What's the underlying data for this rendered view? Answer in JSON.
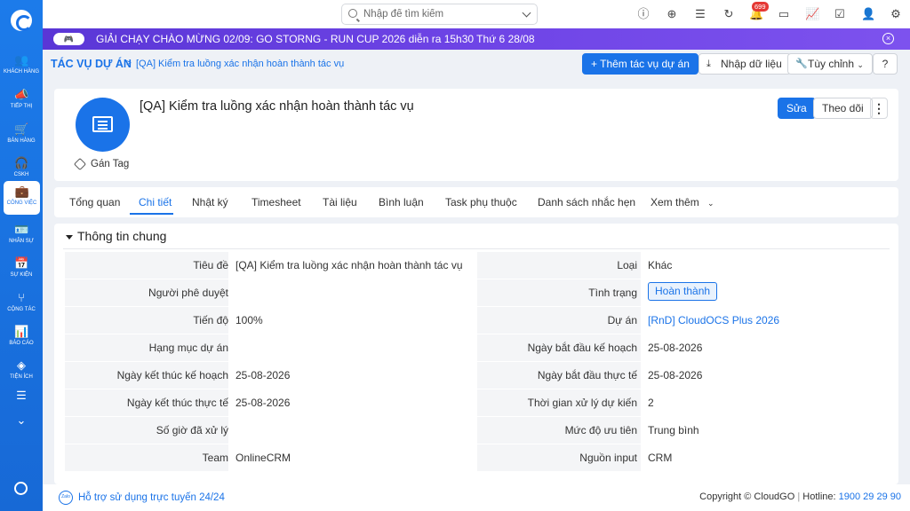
{
  "sidebar": {
    "items": [
      {
        "label": "KHÁCH HÀNG",
        "icon": "users-icon"
      },
      {
        "label": "TIẾP THỊ",
        "icon": "megaphone-icon"
      },
      {
        "label": "BÁN HÀNG",
        "icon": "cart-icon"
      },
      {
        "label": "CSKH",
        "icon": "headset-icon"
      },
      {
        "label": "CÔNG VIỆC",
        "icon": "briefcase-icon"
      },
      {
        "label": "NHÂN SỰ",
        "icon": "id-card-icon"
      },
      {
        "label": "SỰ KIỆN",
        "icon": "calendar-icon"
      },
      {
        "label": "CỘNG TÁC",
        "icon": "branch-icon"
      },
      {
        "label": "BÁO CÁO",
        "icon": "report-icon"
      },
      {
        "label": "TIỆN ÍCH",
        "icon": "layers-icon"
      }
    ]
  },
  "topbar": {
    "search_placeholder": "Nhập để tìm kiếm",
    "notification_count": "699"
  },
  "announcement": {
    "text": "GIẢI CHẠY CHÀO MỪNG 02/09: GO STORNG - RUN CUP 2026 diễn ra 15h30 Thứ 6 28/08"
  },
  "breadcrumb": {
    "root": "TÁC VỤ DỰ ÁN",
    "separator": ">",
    "current": "[QA] Kiểm tra luồng xác nhận hoàn thành tác vụ"
  },
  "actions": {
    "add_task": "+ Thêm tác vụ dự án",
    "import": "Nhập dữ liệu",
    "customize": "Tùy chỉnh",
    "help": "?"
  },
  "header": {
    "title": "[QA] Kiểm tra luồng xác nhận hoàn thành tác vụ",
    "tag_label": "Gán Tag",
    "edit": "Sửa",
    "follow": "Theo dõi"
  },
  "tabs": [
    "Tổng quan",
    "Chi tiết",
    "Nhật ký",
    "Timesheet",
    "Tài liệu",
    "Bình luận",
    "Task phụ thuộc",
    "Danh sách nhắc hẹn",
    "Xem thêm"
  ],
  "section": {
    "title": "Thông tin chung",
    "rows": [
      {
        "left_label": "Tiêu đề",
        "left_value": "[QA] Kiểm tra luồng xác nhận hoàn thành tác vụ",
        "right_label": "Loại",
        "right_value": "Khác"
      },
      {
        "left_label": "Người phê duyệt",
        "left_value": "",
        "right_label": "Tình trạng",
        "right_value": "Hoàn thành"
      },
      {
        "left_label": "Tiến độ",
        "left_value": "100%",
        "right_label": "Dự án",
        "right_value": "[RnD] CloudOCS Plus 2026"
      },
      {
        "left_label": "Hạng mục dự án",
        "left_value": "",
        "right_label": "Ngày bắt đầu kế hoạch",
        "right_value": "25-08-2026"
      },
      {
        "left_label": "Ngày kết thúc kế hoạch",
        "left_value": "25-08-2026",
        "right_label": "Ngày bắt đầu thực tế",
        "right_value": "25-08-2026"
      },
      {
        "left_label": "Ngày kết thúc thực tế",
        "left_value": "25-08-2026",
        "right_label": "Thời gian xử lý dự kiến",
        "right_value": "2"
      },
      {
        "left_label": "Số giờ đã xử lý",
        "left_value": "",
        "right_label": "Mức độ ưu tiên",
        "right_value": "Trung bình"
      },
      {
        "left_label": "Team",
        "left_value": "OnlineCRM",
        "right_label": "Nguồn input",
        "right_value": "CRM"
      }
    ]
  },
  "footer": {
    "support": "Hỗ trợ sử dụng trực tuyến 24/24",
    "copyright": "Copyright © CloudGO",
    "hotline_label": "Hotline:",
    "hotline": "1900 29 29 90"
  }
}
